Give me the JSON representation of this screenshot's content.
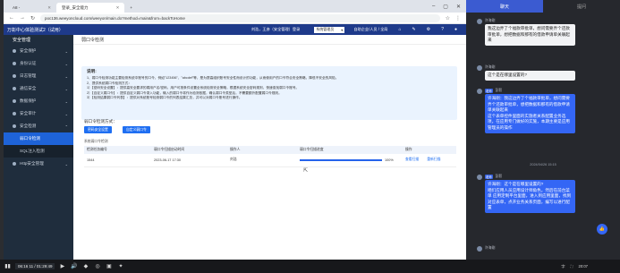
{
  "browser": {
    "tabs": [
      {
        "label": "A8 -"
      },
      {
        "label": "登录_安全能力"
      }
    ],
    "url": "poc136.weeyoncloud.com/weeyon/main.do?method=main&from=backToHome"
  },
  "app": {
    "title": "万彰中心体验测试2（试用）",
    "user_text": "刘浩，王彦（安全管理）登录",
    "system_select": "系统管理员",
    "assistant_text": "自助企业/人员 / 全局"
  },
  "sidebar": {
    "header": "安全管理",
    "items": [
      {
        "label": "安全保护"
      },
      {
        "label": "身份认证"
      },
      {
        "label": "日志管理"
      },
      {
        "label": "通信安全"
      },
      {
        "label": "数据保护"
      },
      {
        "label": "安全审计"
      },
      {
        "label": "安全检测"
      },
      {
        "label": "弱口令检测"
      },
      {
        "label": "SQL注入检测"
      },
      {
        "label": "Http安全管理"
      }
    ]
  },
  "main": {
    "page_title": "弱口令检测",
    "notice": {
      "title": "说明:",
      "lines": [
        "1、弱口令检测功能主要检测系统中账号的口令，例如\"123456\"、\"abcdef\"等，是为提高组织账号安全性而设计的功能，从而使用户的口令符合安全策略，降低不安全的风险。",
        "2、提供系统弱口令检测方式：",
        "1）【密码安全设置】：提供高安全要求的弱用户名/密码，用户可按条件设置全系统检测安全策略，根据系统安全密码规则，快速查找弱口令账号。",
        "2）【自定义弱口令】：提供自定义弱口令录入功能，输入的弱口令将作为检测依据，确认弱口令类型后，不需要额外配置弱口令规则。",
        "3）【检测结果弱口令列表】：提供对系统账号检测弱口令的列表结果汇总，并可以对弱口令账号进行操作。"
      ]
    },
    "mode_label": "弱口令检测方式：",
    "buttons": {
      "password_setting": "密码安全设置",
      "custom_weak": "自定义弱口令"
    },
    "table_caption": "系统弱口令检测",
    "table": {
      "columns": [
        "检测任务编号",
        "弱口令扫描启动时间",
        "操作人",
        "弱口令扫描进度",
        "操作"
      ],
      "rows": [
        {
          "id": "1544",
          "time": "2023-06-17 17:30",
          "operator": "刘浩",
          "progress": 100,
          "progress_label": "100%",
          "actions": [
            "查看扫描",
            "重新扫描"
          ]
        }
      ]
    }
  },
  "taskbar": {
    "recording": "06:16 11 / 01:29:49",
    "time": "20:07"
  },
  "chat": {
    "tabs": [
      "聊天",
      "提问"
    ],
    "messages": [
      {
        "sender": "许海刚",
        "teacher": false,
        "text": "我这边弄了个福款审批单，想问需要弄个还款审批单，想把数据和那有的借款申请单关联起来"
      },
      {
        "sender": "许海刚",
        "teacher": false,
        "text": "这个是在哪里设置的?"
      },
      {
        "sender": "彭毅",
        "teacher": true,
        "text": "许海刚：我这边弄了个福款审批单，想问需要弄个还款审批单，想把数据和那有的借款申请单关联起来\n这个表单控件里面的实施者关系配置业务选项，在应用专门做好的实施，本期主要是应用管理员的操作"
      },
      {
        "sender": "彭毅",
        "teacher": true,
        "text": "许海刚：这个是在哪里设置的?\n咱们应用人员应用设计师角色，然后在前台菜单 应用定制平台里面，进入到应用里面，找到对应表单，点开业务关系页面，编写以进行配置"
      },
      {
        "sender": "许海刚",
        "teacher": false,
        "text": "现在弄的后台是哪个版本的"
      }
    ],
    "timestamp": "2024/04/26 15:15"
  },
  "colors": {
    "app_bar": "#1e3a8a",
    "sidebar": "#1f2d3d",
    "accent": "#1f6ff2",
    "chat_tab_active": "#3b5bd1"
  }
}
